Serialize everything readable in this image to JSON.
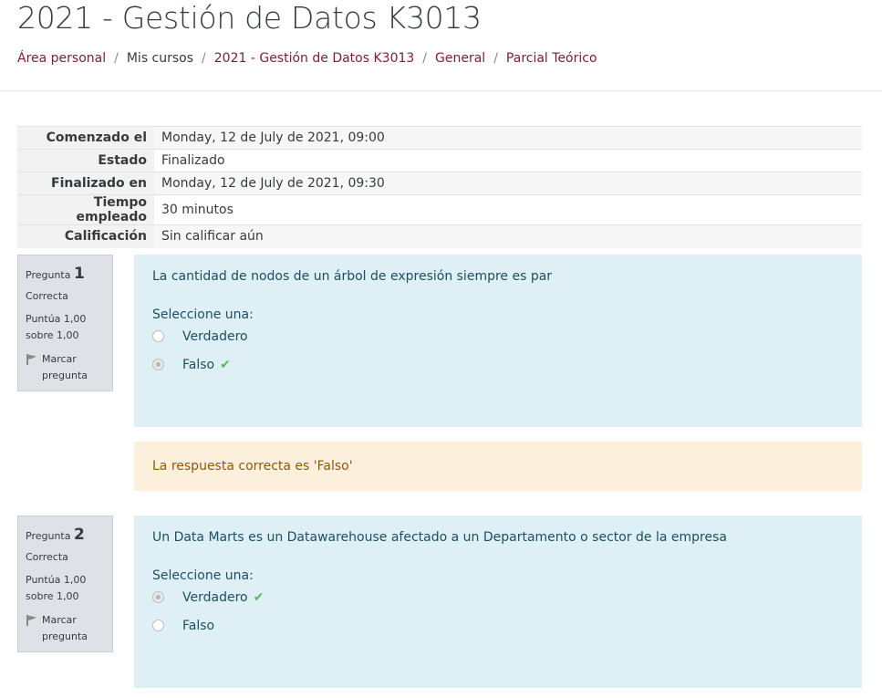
{
  "page": {
    "title": "2021 - Gestión de Datos K3013"
  },
  "breadcrumb": [
    {
      "label": "Área personal",
      "link": true
    },
    {
      "label": "Mis cursos",
      "link": false
    },
    {
      "label": "2021 - Gestión de Datos K3013",
      "link": true
    },
    {
      "label": "General",
      "link": true
    },
    {
      "label": "Parcial Teórico",
      "link": true
    }
  ],
  "summary": [
    {
      "label": "Comenzado el",
      "value": "Monday, 12 de July de 2021, 09:00"
    },
    {
      "label": "Estado",
      "value": "Finalizado"
    },
    {
      "label": "Finalizado en",
      "value": "Monday, 12 de July de 2021, 09:30"
    },
    {
      "label": "Tiempo empleado",
      "value": "30 minutos"
    },
    {
      "label": "Calificación",
      "value": "Sin calificar aún"
    }
  ],
  "questions": [
    {
      "prefix": "Pregunta",
      "number": "1",
      "state": "Correcta",
      "grade_line1": "Puntúa 1,00",
      "grade_line2": "sobre 1,00",
      "flag_line1": "Marcar",
      "flag_line2": "pregunta",
      "text": "La cantidad de nodos de un árbol de expresión siempre es par",
      "prompt": "Seleccione una:",
      "options": [
        {
          "label": "Verdadero",
          "selected": false,
          "correct_mark": false
        },
        {
          "label": "Falso",
          "selected": true,
          "correct_mark": true
        }
      ],
      "feedback": "La respuesta correcta es 'Falso'"
    },
    {
      "prefix": "Pregunta",
      "number": "2",
      "state": "Correcta",
      "grade_line1": "Puntúa 1,00",
      "grade_line2": "sobre 1,00",
      "flag_line1": "Marcar",
      "flag_line2": "pregunta",
      "text": "Un Data Marts es un Datawarehouse afectado a un Departamento o sector de la empresa",
      "prompt": "Seleccione una:",
      "options": [
        {
          "label": "Verdadero",
          "selected": true,
          "correct_mark": true
        },
        {
          "label": "Falso",
          "selected": false,
          "correct_mark": false
        }
      ]
    }
  ],
  "icons": {
    "check": "check-icon",
    "flag": "flag-icon"
  },
  "colors": {
    "link": "#7a1e35",
    "question_bg": "#def0f6",
    "feedback_bg": "#fcefdc",
    "correct": "#5cb85c"
  }
}
